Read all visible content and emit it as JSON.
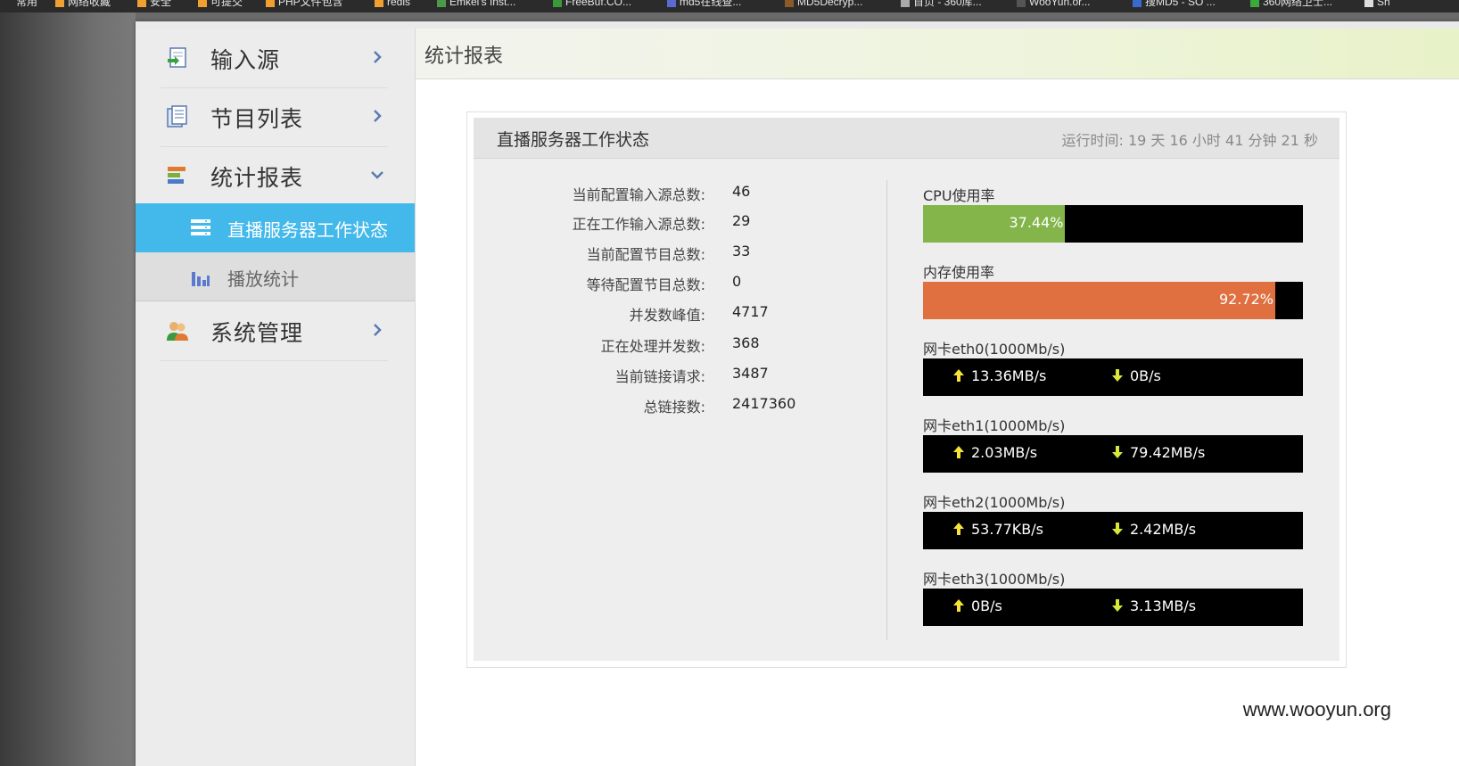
{
  "bookmarks": [
    "常用",
    "网络收藏",
    "安全",
    "可提交",
    "PHP文件包含",
    "redis",
    "Emkei's Inst...",
    "FreeBuf.CO...",
    "md5在线查...",
    "MD5Decryp...",
    "首页 - 360库...",
    "WooYun.or...",
    "搜MD5 - SO ...",
    "360网络卫士...",
    "Sh"
  ],
  "sidebar": {
    "items": [
      {
        "label": "输入源",
        "icon": "input-source-icon"
      },
      {
        "label": "节目列表",
        "icon": "program-list-icon"
      },
      {
        "label": "统计报表",
        "icon": "report-icon"
      },
      {
        "label": "系统管理",
        "icon": "users-icon"
      }
    ],
    "sub_items": [
      {
        "label": "直播服务器工作状态",
        "icon": "server-list-icon",
        "active": true
      },
      {
        "label": "播放统计",
        "icon": "bar-chart-icon",
        "active": false
      }
    ]
  },
  "header": {
    "title": "统计报表"
  },
  "panel": {
    "title": "直播服务器工作状态",
    "uptime_label": "运行时间:",
    "uptime_value": "19 天 16 小时 41 分钟 21 秒",
    "stats": [
      {
        "label": "当前配置输入源总数:",
        "value": "46"
      },
      {
        "label": "正在工作输入源总数:",
        "value": "29"
      },
      {
        "label": "当前配置节目总数:",
        "value": "33"
      },
      {
        "label": "等待配置节目总数:",
        "value": "0"
      },
      {
        "label": "并发数峰值:",
        "value": "4717"
      },
      {
        "label": "正在处理并发数:",
        "value": "368"
      },
      {
        "label": "当前链接请求:",
        "value": "3487"
      },
      {
        "label": "总链接数:",
        "value": "2417360"
      }
    ],
    "cpu": {
      "label": "CPU使用率",
      "percent": 37.44,
      "text": "37.44%",
      "color": "#83b54a"
    },
    "memory": {
      "label": "内存使用率",
      "percent": 92.72,
      "text": "92.72%",
      "color": "#e07040"
    },
    "network": [
      {
        "label": "网卡eth0(1000Mb/s)",
        "up": "13.36MB/s",
        "down": "0B/s"
      },
      {
        "label": "网卡eth1(1000Mb/s)",
        "up": "2.03MB/s",
        "down": "79.42MB/s"
      },
      {
        "label": "网卡eth2(1000Mb/s)",
        "up": "53.77KB/s",
        "down": "2.42MB/s"
      },
      {
        "label": "网卡eth3(1000Mb/s)",
        "up": "0B/s",
        "down": "3.13MB/s"
      }
    ]
  },
  "colors": {
    "active_blue": "#43b8ea",
    "up_arrow": "#f5e23a",
    "down_arrow": "#d8e83a"
  },
  "watermark": "www.wooyun.org"
}
